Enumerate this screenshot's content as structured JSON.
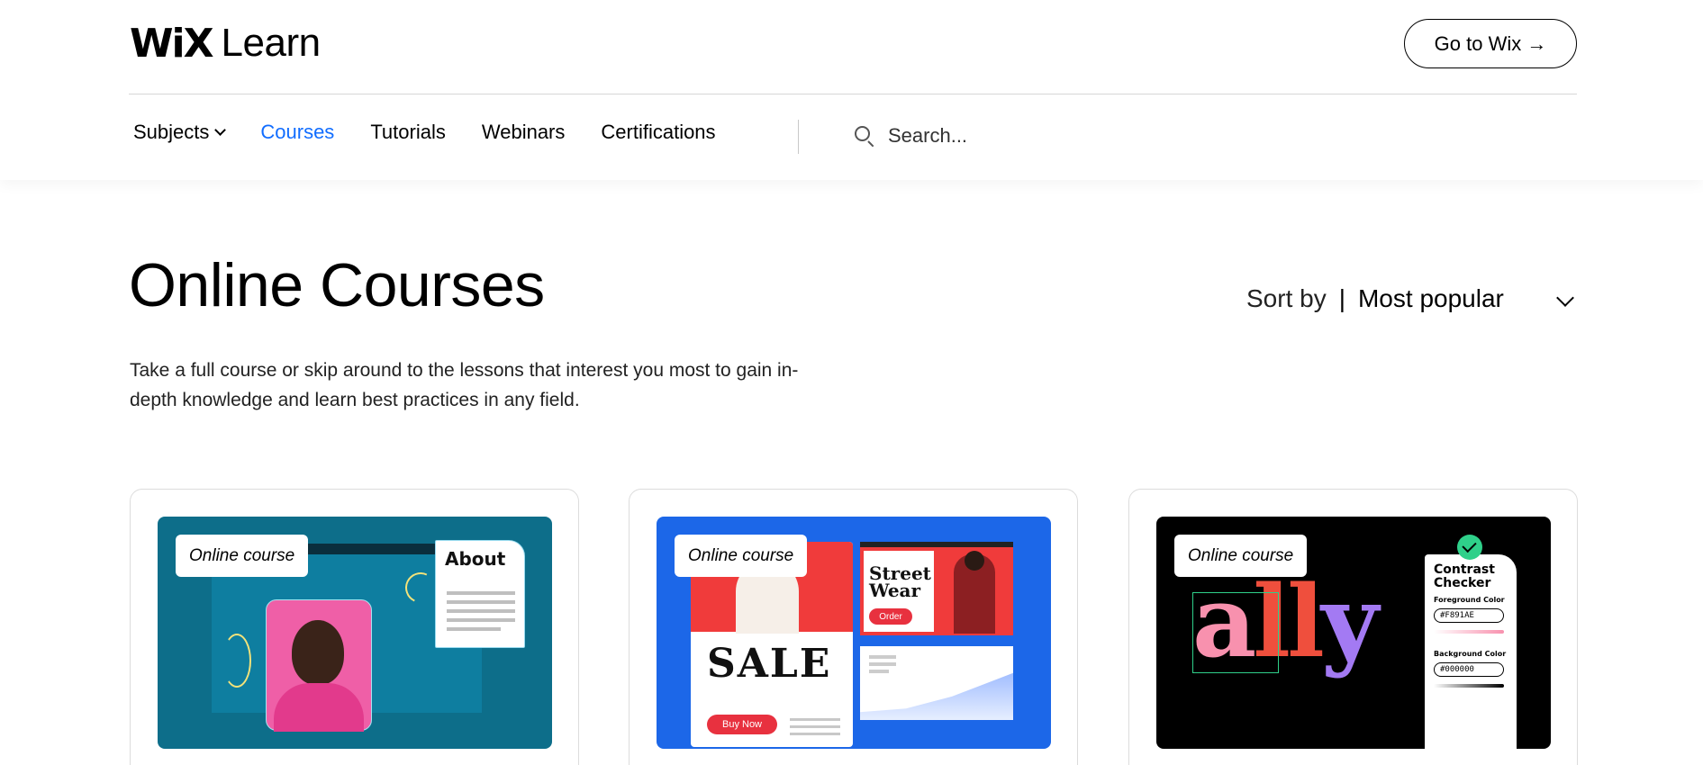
{
  "header": {
    "logo_wix": "WiX",
    "logo_learn": "Learn",
    "go_button": "Go to Wix →"
  },
  "nav": {
    "items": [
      {
        "label": "Subjects",
        "has_dropdown": true,
        "active": false
      },
      {
        "label": "Courses",
        "active": true
      },
      {
        "label": "Tutorials",
        "active": false
      },
      {
        "label": "Webinars",
        "active": false
      },
      {
        "label": "Certifications",
        "active": false
      }
    ],
    "search_placeholder": "Search...",
    "active_color": "#116dff"
  },
  "main": {
    "title": "Online Courses",
    "subtitle": "Take a full course or skip around to the lessons that interest you most to gain in-depth knowledge and learn best practices in any field.",
    "sort": {
      "label": "Sort by",
      "separator": "|",
      "value": "Most popular"
    }
  },
  "cards": [
    {
      "badge": "Online course",
      "media": {
        "bg": "#0d6e8a",
        "about_title": "About"
      }
    },
    {
      "badge": "Online course",
      "media": {
        "bg": "#1c67e8",
        "sale_text": "SALE",
        "buy_now": "Buy Now",
        "street_wear": "Street Wear",
        "order": "Order"
      }
    },
    {
      "badge": "Online course",
      "media": {
        "bg": "#000000",
        "ally_a": "a",
        "ally_ll": "ll",
        "ally_y": "y",
        "panel_title": "Contrast Checker",
        "fg_label": "Foreground Color",
        "fg_value": "#F891AE",
        "bg_label": "Background Color",
        "bg_value": "#000000"
      }
    }
  ]
}
